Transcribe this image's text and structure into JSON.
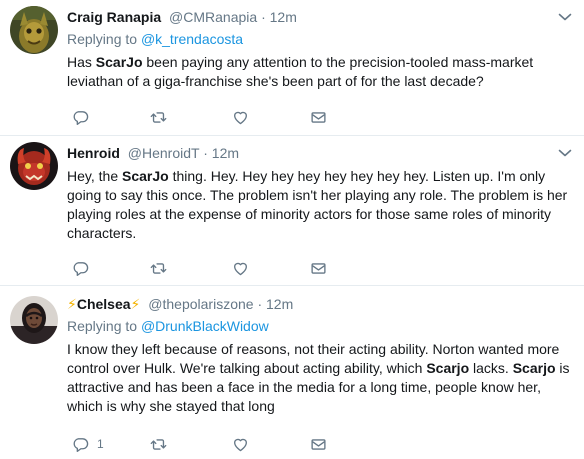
{
  "tweets": [
    {
      "name": "Craig Ranapia",
      "handle": "@CMRanapia",
      "dot": "·",
      "time": "12m",
      "reply_prefix": "Replying to",
      "reply_to": "@k_trendacosta",
      "text_1": "Has ",
      "bold_1": "ScarJo",
      "text_2": " been paying any attention to the precision-tooled mass-market leviathan of a giga-franchise she's been part of for the last decade?"
    },
    {
      "name": "Henroid",
      "handle": "@HenroidT",
      "dot": "·",
      "time": "12m",
      "text_1": "Hey, the ",
      "bold_1": "ScarJo",
      "text_2": " thing. Hey. Hey hey hey hey hey hey hey. Listen up. I'm only going to say this once. The problem isn't her playing any role. The problem is her playing roles at the expense of minority actors for those same roles of minority characters."
    },
    {
      "name_prefix": "⚡",
      "name": "Chelsea",
      "name_suffix": "⚡",
      "handle": "@thepolariszone",
      "dot": "·",
      "time": "12m",
      "reply_prefix": "Replying to",
      "reply_to": "@DrunkBlackWidow",
      "text_1": "I know they left because of reasons, not their acting ability. Norton wanted more control over Hulk. We're talking about acting ability, which ",
      "bold_1": "Scarjo",
      "text_2": " lacks. ",
      "bold_2": "Scarjo",
      "text_3": " is attractive and has been a face in the media for a long time, people know her, which is why she stayed that long",
      "reply_count": "1"
    }
  ],
  "icons": {
    "reply": "reply-icon",
    "retweet": "retweet-icon",
    "like": "heart-icon",
    "dm": "envelope-icon",
    "caret": "chevron-down-icon"
  },
  "colors": {
    "link": "#1b95e0",
    "secondary": "#657786",
    "text": "#14171a",
    "divider": "#e6ecf0",
    "bolt": "#f5b400"
  }
}
